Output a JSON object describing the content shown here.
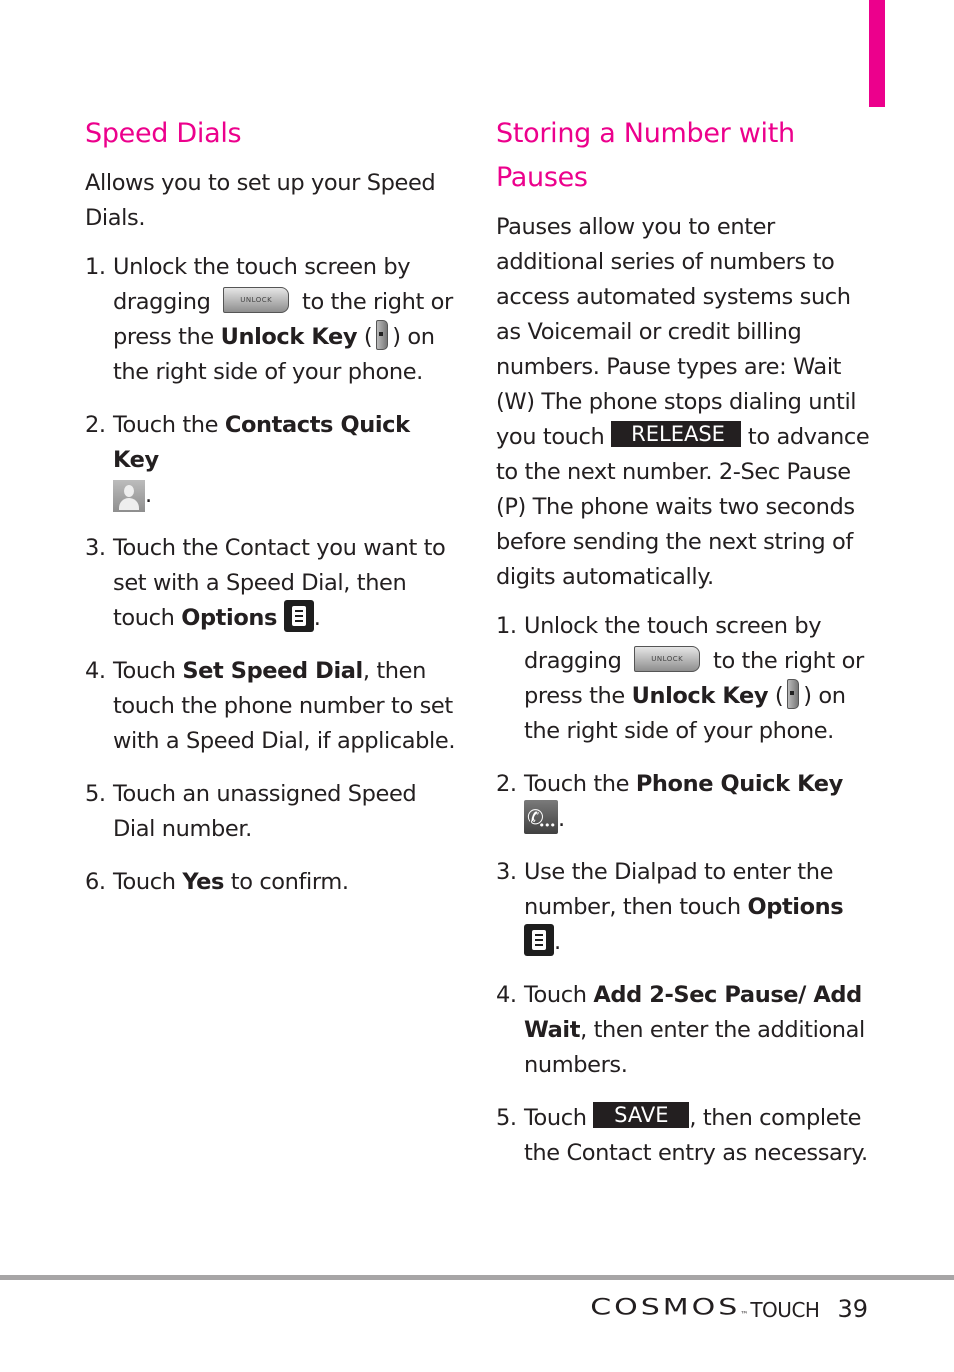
{
  "colors": {
    "accent": "#ec008c",
    "text": "#231f20",
    "rule": "#a7a5a6"
  },
  "left": {
    "title": "Speed Dials",
    "intro": "Allows you to set up your Speed Dials.",
    "steps": [
      {
        "num": "1.",
        "t1": "Unlock the touch screen by dragging",
        "icon1": "UNLOCK",
        "t2": "to the right or press the",
        "b1": "Unlock Key",
        "t3": "(",
        "t4": ") on the right side of your phone."
      },
      {
        "num": "2.",
        "t1": "Touch the",
        "b1": "Contacts Quick Key",
        "t2": "."
      },
      {
        "num": "3.",
        "t1": "Touch the Contact you want to set with a Speed Dial, then touch",
        "b1": "Options",
        "t2": "."
      },
      {
        "num": "4.",
        "t1": "Touch",
        "b1": "Set Speed Dial",
        "t2": ", then touch the phone number to set with a Speed Dial, if applicable."
      },
      {
        "num": "5.",
        "t1": "Touch an unassigned Speed Dial number."
      },
      {
        "num": "6.",
        "t1": "Touch",
        "b1": "Yes",
        "t2": "to confirm."
      }
    ]
  },
  "right": {
    "title": "Storing a Number with Pauses",
    "intro1": "Pauses allow you to enter additional series of numbers to access automated systems such as Voicemail or credit billing numbers. Pause types are: Wait (W) The phone stops dialing until you touch",
    "release_label": "RELEASE",
    "intro2": "to advance to the next number. 2-Sec Pause (P) The phone waits two seconds before sending the next string of digits automatically.",
    "steps": [
      {
        "num": "1.",
        "t1": "Unlock the touch screen by dragging",
        "icon1": "UNLOCK",
        "t2": "to the right or press the",
        "b1": "Unlock Key",
        "t3": "(",
        "t4": ") on the right side of your phone."
      },
      {
        "num": "2.",
        "t1": "Touch the",
        "b1": "Phone Quick Key",
        "t2": "."
      },
      {
        "num": "3.",
        "t1": "Use the Dialpad to enter the number, then touch",
        "b1": "Options",
        "t2": "."
      },
      {
        "num": "4.",
        "t1": "Touch",
        "b1": "Add 2-Sec Pause/ Add Wait",
        "t2": ", then enter the additional numbers."
      },
      {
        "num": "5.",
        "t1": "Touch",
        "save_label": "SAVE",
        "t2": ", then complete the Contact entry as necessary."
      }
    ]
  },
  "footer": {
    "brand": "COSMOS",
    "tm": "™",
    "model": "TOUCH",
    "page": "39"
  }
}
